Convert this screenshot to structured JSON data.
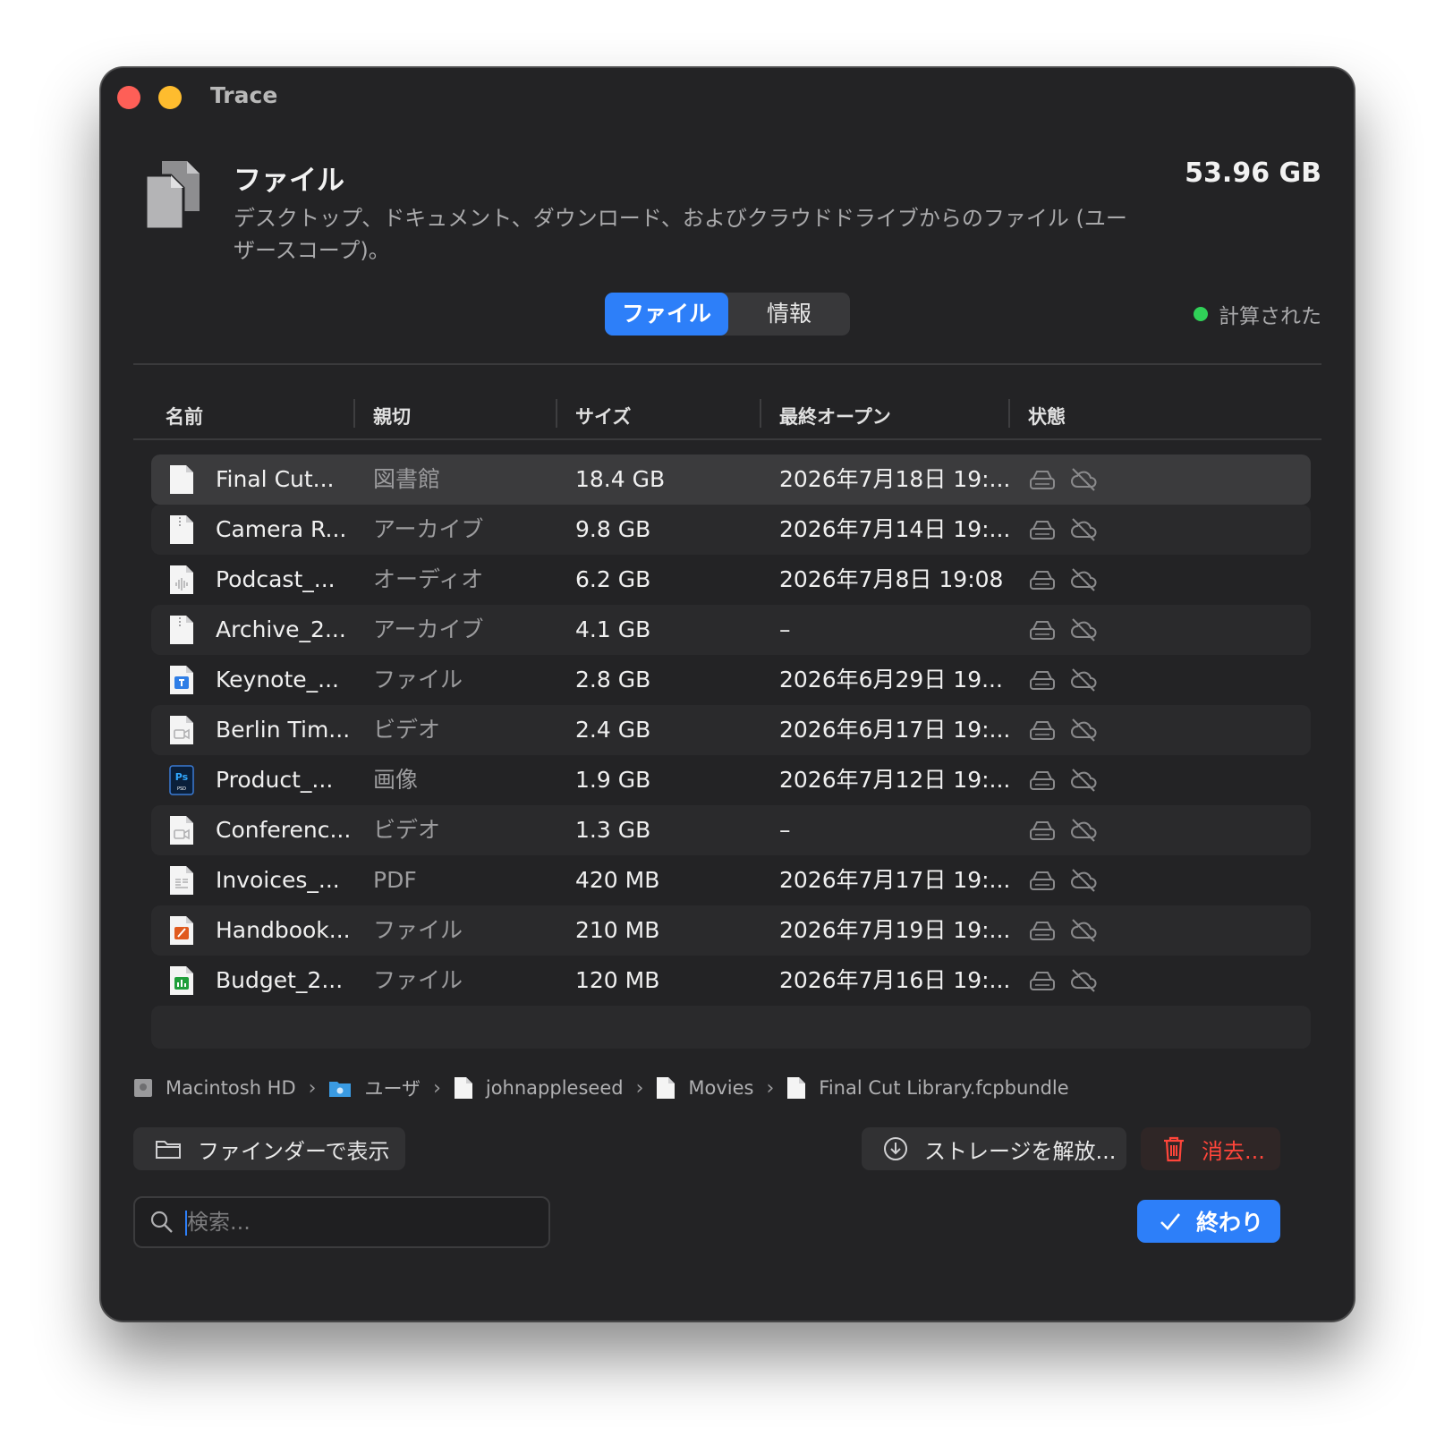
{
  "window": {
    "title": "Trace"
  },
  "header": {
    "title": "ファイル",
    "description": "デスクトップ、ドキュメント、ダウンロード、およびクラウドドライブからのファイル (ユーザースコープ)。",
    "total_size": "53.96 GB"
  },
  "tabs": [
    {
      "label": "ファイル",
      "active": true
    },
    {
      "label": "情報",
      "active": false
    }
  ],
  "status": {
    "label": "計算された",
    "color": "#30d158"
  },
  "columns": [
    "名前",
    "親切",
    "サイズ",
    "最終オープン",
    "状態"
  ],
  "rows": [
    {
      "name": "Final Cut...",
      "kind": "図書館",
      "size": "18.4 GB",
      "last_opened": "2026年7月18日 19:...",
      "icon": "document-icon"
    },
    {
      "name": "Camera R...",
      "kind": "アーカイブ",
      "size": "9.8 GB",
      "last_opened": "2026年7月14日 19:...",
      "icon": "archive-icon"
    },
    {
      "name": "Podcast_...",
      "kind": "オーディオ",
      "size": "6.2 GB",
      "last_opened": "2026年7月8日 19:08",
      "icon": "audio-file-icon"
    },
    {
      "name": "Archive_2...",
      "kind": "アーカイブ",
      "size": "4.1 GB",
      "last_opened": "–",
      "icon": "archive-icon"
    },
    {
      "name": "Keynote_...",
      "kind": "ファイル",
      "size": "2.8 GB",
      "last_opened": "2026年6月29日 19...",
      "icon": "keynote-icon"
    },
    {
      "name": "Berlin Tim...",
      "kind": "ビデオ",
      "size": "2.4 GB",
      "last_opened": "2026年6月17日 19:...",
      "icon": "video-file-icon"
    },
    {
      "name": "Product_...",
      "kind": "画像",
      "size": "1.9 GB",
      "last_opened": "2026年7月12日 19:...",
      "icon": "photoshop-icon"
    },
    {
      "name": "Conferenc...",
      "kind": "ビデオ",
      "size": "1.3 GB",
      "last_opened": "–",
      "icon": "video-file-icon"
    },
    {
      "name": "Invoices_...",
      "kind": "PDF",
      "size": "420 MB",
      "last_opened": "2026年7月17日 19:...",
      "icon": "pdf-icon"
    },
    {
      "name": "Handbook...",
      "kind": "ファイル",
      "size": "210 MB",
      "last_opened": "2026年7月19日 19:...",
      "icon": "pages-icon"
    },
    {
      "name": "Budget_2...",
      "kind": "ファイル",
      "size": "120 MB",
      "last_opened": "2026年7月16日 19:...",
      "icon": "numbers-icon"
    }
  ],
  "breadcrumb": [
    {
      "label": "Macintosh HD",
      "icon": "hard-drive-icon"
    },
    {
      "label": "ユーザ",
      "icon": "folder-icon"
    },
    {
      "label": "johnappleseed",
      "icon": "document-icon"
    },
    {
      "label": "Movies",
      "icon": "document-icon"
    },
    {
      "label": "Final Cut Library.fcpbundle",
      "icon": "document-icon"
    }
  ],
  "actions": {
    "show_in_finder": "ファインダーで表示",
    "free_storage": "ストレージを解放...",
    "erase": "消去...",
    "done": "終わり"
  },
  "search": {
    "placeholder": "検索...",
    "value": ""
  },
  "colors": {
    "accent": "#2d7ff9",
    "danger": "#ff453a",
    "window_bg": "#232325"
  }
}
